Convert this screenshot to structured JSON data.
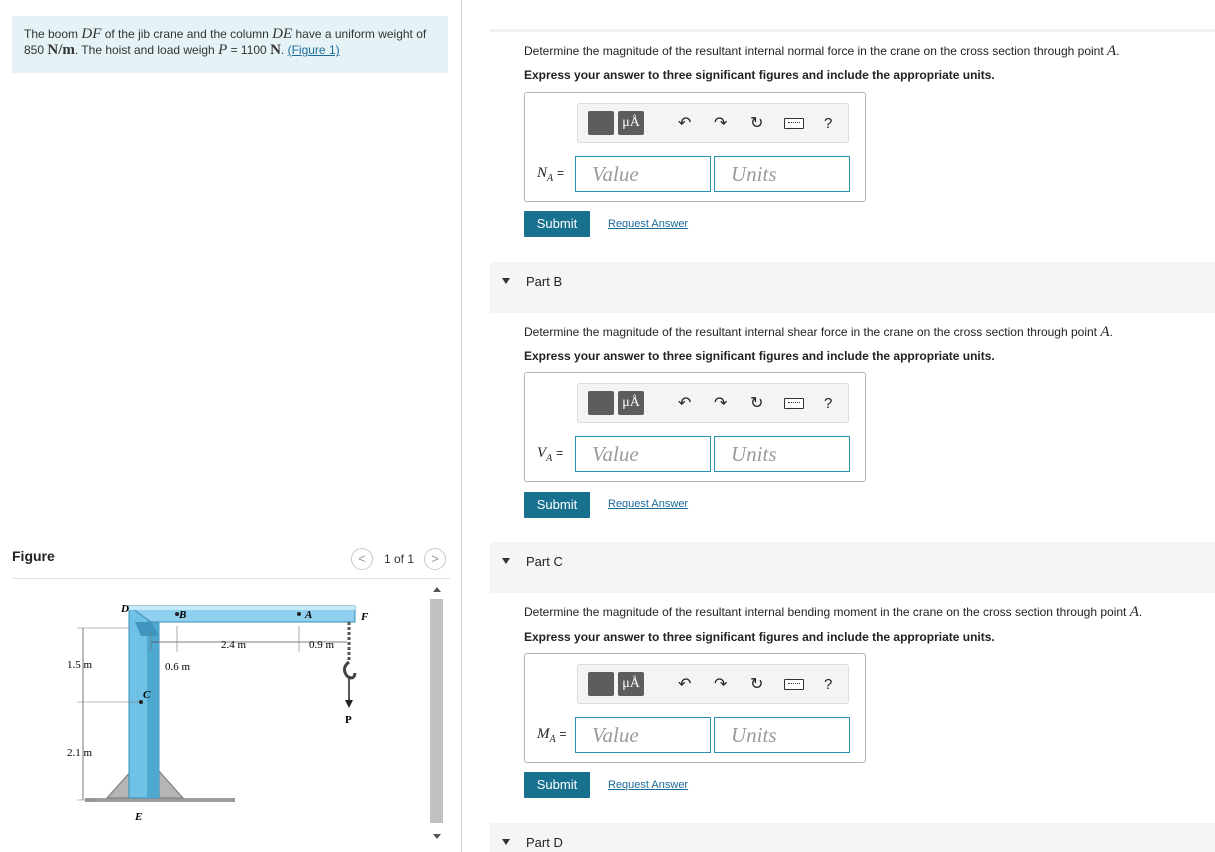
{
  "problem": {
    "t1": "The boom ",
    "boom": "DF",
    "t2": " of the jib crane and the column ",
    "column": "DE",
    "t3": " have a uniform weight of 850 ",
    "unit1": "N/m",
    "t4": ". The hoist and load weigh ",
    "p": "P",
    "t5": " = 1100 ",
    "unit2": "N",
    "t6": ". ",
    "figure_link": "(Figure 1)"
  },
  "figure": {
    "title": "Figure",
    "counter": "1 of 1",
    "prev": "<",
    "next": ">",
    "labels": {
      "D": "D",
      "B": "B",
      "A": "A",
      "F": "F",
      "C": "C",
      "E": "E",
      "P": "P",
      "d24": "2.4 m",
      "d09": "0.9 m",
      "d06": "0.6 m",
      "d15": "1.5 m",
      "d21": "2.1 m"
    }
  },
  "parts": [
    {
      "question": "Determine the magnitude of the resultant internal normal force in the crane on the cross section through point ",
      "point": "A",
      "instruction": "Express your answer to three significant figures and include the appropriate units.",
      "var": "N",
      "sub": "A",
      "eq": "=",
      "value_placeholder": "Value",
      "units_placeholder": "Units",
      "submit": "Submit",
      "request": "Request Answer"
    },
    {
      "header": "Part B",
      "question": "Determine the magnitude of the resultant internal shear force in the crane on the cross section through point ",
      "point": "A",
      "instruction": "Express your answer to three significant figures and include the appropriate units.",
      "var": "V",
      "sub": "A",
      "eq": "=",
      "value_placeholder": "Value",
      "units_placeholder": "Units",
      "submit": "Submit",
      "request": "Request Answer"
    },
    {
      "header": "Part C",
      "question": "Determine the magnitude of the resultant internal bending moment in the crane on the cross section through point ",
      "point": "A",
      "instruction": "Express your answer to three significant figures and include the appropriate units.",
      "var": "M",
      "sub": "A",
      "eq": "=",
      "value_placeholder": "Value",
      "units_placeholder": "Units",
      "submit": "Submit",
      "request": "Request Answer"
    },
    {
      "header": "Part D"
    }
  ],
  "toolbar": {
    "mu": "μÅ",
    "undo": "↶",
    "redo": "↷",
    "reset": "↻",
    "help": "?"
  }
}
